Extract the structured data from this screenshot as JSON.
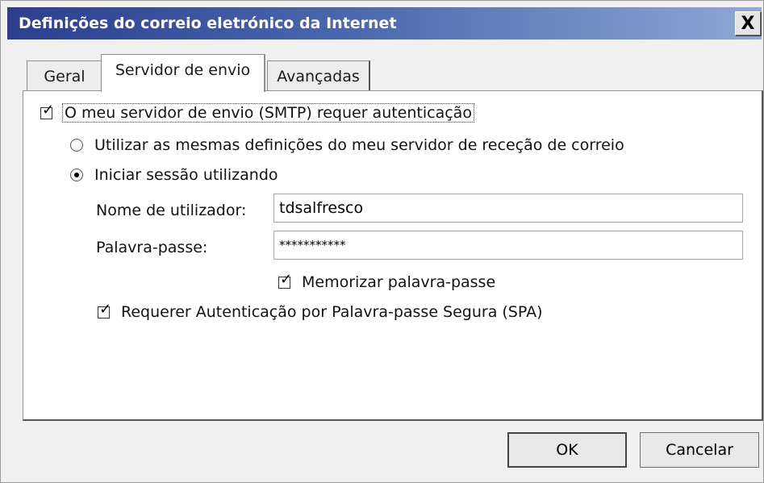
{
  "window": {
    "title": "Definições do correio eletrónico da Internet",
    "close_glyph": "X"
  },
  "tabs": [
    {
      "label": "Geral",
      "active": false
    },
    {
      "label": "Servidor de envio",
      "active": true
    },
    {
      "label": "Avançadas",
      "active": false
    }
  ],
  "smtp": {
    "requires_auth_label": "O meu servidor de envio (SMTP) requer autenticação",
    "requires_auth_checked": true,
    "same_settings_label": "Utilizar as mesmas definições do meu servidor de receção de correio",
    "same_settings_selected": false,
    "login_label": "Iniciar sessão utilizando",
    "login_selected": true,
    "username_label": "Nome de utilizador:",
    "username_value": "tdsalfresco",
    "password_label": "Palavra-passe:",
    "password_value": "***********",
    "remember_label": "Memorizar palavra-passe",
    "remember_checked": true,
    "spa_label": "Requerer Autenticação por Palavra-passe Segura (SPA)",
    "spa_checked": true
  },
  "buttons": {
    "ok_label": "OK",
    "cancel_label": "Cancelar"
  },
  "colors": {
    "titlebar_start": "#2b3f8e",
    "titlebar_end": "#8fa8d6"
  },
  "icons": {
    "close": "close-icon",
    "check": "checkmark-icon",
    "radio": "radio-dot-icon"
  }
}
